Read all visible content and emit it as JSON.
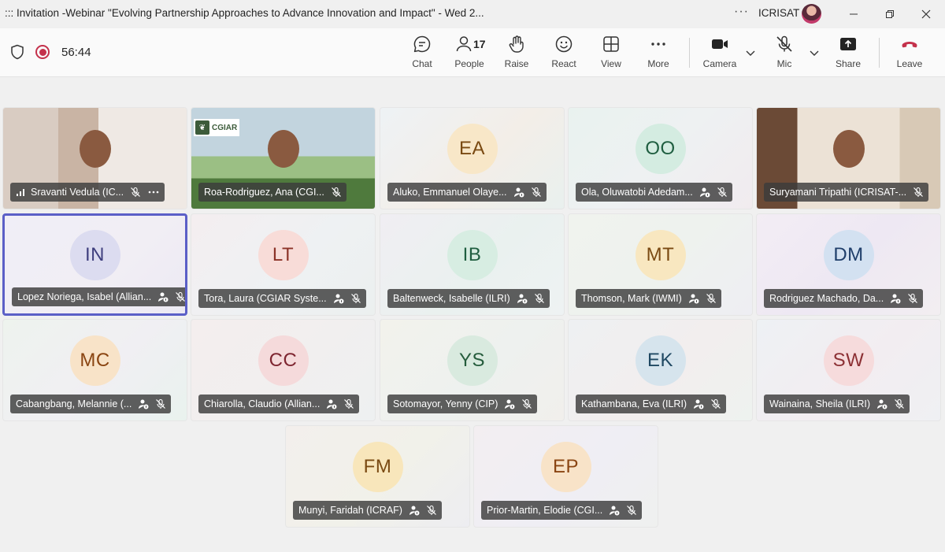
{
  "window": {
    "title": "::: Invitation -Webinar \"Evolving Partnership Approaches to Advance Innovation and Impact\" - Wed 2...",
    "org": "ICRISAT",
    "more": "···"
  },
  "meeting": {
    "timer": "56:44",
    "people_count": "17"
  },
  "toolbar": {
    "chat": "Chat",
    "people": "People",
    "raise": "Raise",
    "react": "React",
    "view": "View",
    "more": "More",
    "camera": "Camera",
    "mic": "Mic",
    "share": "Share",
    "leave": "Leave"
  },
  "logo": {
    "text": "CGIAR"
  },
  "colors": {
    "accent": "#5b5fc7",
    "leave": "#c4314b"
  },
  "participants": [
    {
      "name": "Sravanti Vedula (IC...",
      "video": true
    },
    {
      "name": "Roa-Rodriguez, Ana (CGI...",
      "video": true
    },
    {
      "name": "Aluko, Emmanuel Olaye...",
      "initials": "EA"
    },
    {
      "name": "Ola, Oluwatobi Adedam...",
      "initials": "OO"
    },
    {
      "name": "Suryamani Tripathi (ICRISAT-...",
      "video": true
    },
    {
      "name": "Lopez Noriega, Isabel (Allian...",
      "initials": "IN"
    },
    {
      "name": "Tora, Laura (CGIAR Syste...",
      "initials": "LT"
    },
    {
      "name": "Baltenweck, Isabelle (ILRI)",
      "initials": "IB"
    },
    {
      "name": "Thomson, Mark (IWMI)",
      "initials": "MT"
    },
    {
      "name": "Rodriguez Machado, Da...",
      "initials": "DM"
    },
    {
      "name": "Cabangbang, Melannie (...",
      "initials": "MC"
    },
    {
      "name": "Chiarolla, Claudio (Allian...",
      "initials": "CC"
    },
    {
      "name": "Sotomayor, Yenny (CIP)",
      "initials": "YS"
    },
    {
      "name": "Kathambana, Eva (ILRI)",
      "initials": "EK"
    },
    {
      "name": "Wainaina, Sheila (ILRI)",
      "initials": "SW"
    },
    {
      "name": "Munyi, Faridah (ICRAF)",
      "initials": "FM"
    },
    {
      "name": "Prior-Martin, Elodie (CGI...",
      "initials": "EP"
    }
  ]
}
